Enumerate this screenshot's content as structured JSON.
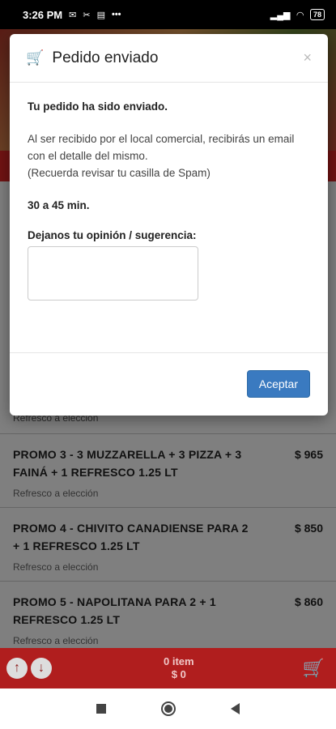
{
  "status_bar": {
    "time": "3:26 PM",
    "battery": "78"
  },
  "modal": {
    "title": "Pedido enviado",
    "close_symbol": "×",
    "heading": "Tu pedido ha sido enviado.",
    "message_line1": "Al ser recibido por el local comercial, recibirás un email con el detalle del mismo.",
    "message_line2": "(Recuerda revisar tu casilla de Spam)",
    "time_estimate": "30 a 45 min.",
    "opinion_label": "Dejanos tu opinión / sugerencia:",
    "opinion_value": "",
    "accept_label": "Aceptar"
  },
  "menu": {
    "snippet": "Refresco a elección",
    "items": [
      {
        "name": "PROMO 3 - 3 MUZZARELLA + 3 PIZZA + 3 FAINÁ + 1 REFRESCO 1.25 LT",
        "price": "$ 965",
        "note": "Refresco a elección"
      },
      {
        "name": "PROMO 4 - CHIVITO CANADIENSE PARA 2 + 1 REFRESCO 1.25 LT",
        "price": "$ 850",
        "note": "Refresco a elección"
      },
      {
        "name": "PROMO 5 - NAPOLITANA PARA 2 + 1 REFRESCO 1.25 LT",
        "price": "$ 860",
        "note": "Refresco a elección"
      }
    ]
  },
  "cart": {
    "items": "0 item",
    "total": "$ 0"
  },
  "icons": {
    "cart": "shopping-cart-icon",
    "up": "arrow-up-icon",
    "down": "arrow-down-icon"
  }
}
